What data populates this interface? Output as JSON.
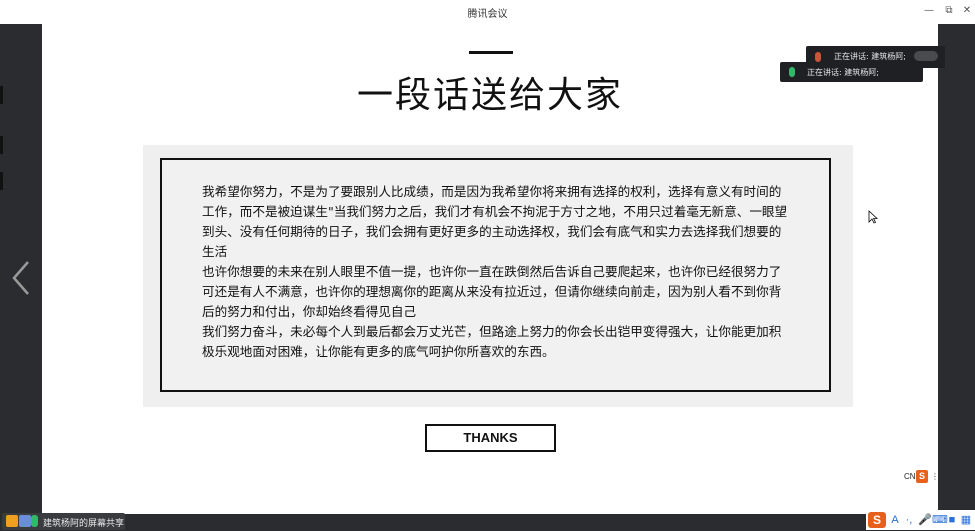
{
  "window": {
    "title": "腾讯会议",
    "controls": [
      "minimize",
      "restore",
      "close"
    ]
  },
  "slide": {
    "title": "一段话送给大家",
    "paragraphs": [
      "我希望你努力，不是为了要跟别人比成绩，而是因为我希望你将来拥有选择的权利，选择有意义有时间的工作，而不是被迫谋生\"当我们努力之后，我们才有机会不拘泥于方寸之地，不用只过着毫无新意、一眼望到头、没有任何期待的日子，我们会拥有更好更多的主动选择权，我们会有底气和实力去选择我们想要的生活",
      "也许你想要的未来在别人眼里不值一提，也许你一直在跌倒然后告诉自己要爬起来，也许你已经很努力了可还是有人不满意，也许你的理想离你的距离从来没有拉近过，但请你继续向前走，因为别人看不到你背后的努力和付出，你却始终看得见自己",
      "我们努力奋斗，未必每个人到最后都会万丈光芒，但路途上努力的你会长出铠甲变得强大，让你能更加积极乐观地面对困难，让你能有更多的底气呵护你所喜欢的东西。"
    ],
    "thanks_label": "THANKS"
  },
  "speaking": [
    {
      "label": "正在讲话: 建筑杨阿;"
    },
    {
      "label": "正在讲话: 建筑杨阿;"
    }
  ],
  "share_bar": {
    "label": "建筑杨阿的屏幕共享"
  },
  "ime": {
    "logo": "S",
    "lang": "CN",
    "items": [
      "A",
      "·,",
      "mic",
      "keyboard",
      "skin",
      "tools",
      "grid"
    ]
  },
  "icons": {
    "nav_prev": "chevron-left-icon",
    "cursor": "mouse-pointer-icon"
  },
  "colors": {
    "accent_orange": "#e8601c",
    "dark_bar": "#2b2c2f",
    "panel_gray": "#efefef"
  }
}
